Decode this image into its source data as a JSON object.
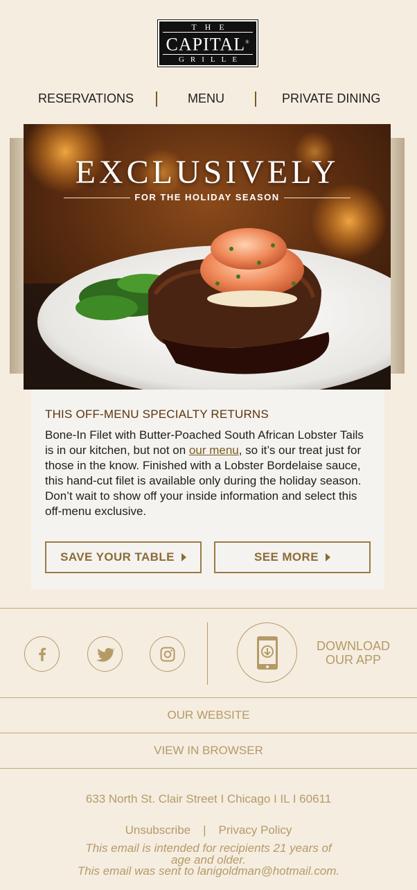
{
  "brand": {
    "the": "THE",
    "capital": "CAPITAL",
    "reg": "®",
    "grille": "GRILLE"
  },
  "nav": {
    "reservations": "RESERVATIONS",
    "menu": "MENU",
    "private_dining": "PRIVATE DINING"
  },
  "hero": {
    "headline": "EXCLUSIVELY",
    "subhead": "FOR THE HOLIDAY SEASON"
  },
  "feature": {
    "heading": "THIS OFF-MENU SPECIALTY RETURNS",
    "body_before_link": "Bone-In Filet with Butter-Poached South African Lobster Tails is in our kitchen, but not on ",
    "link_text": "our menu",
    "body_after_link": ", so it’s our treat just for those in the know. Finished with a Lobster Bordelaise sauce, this hand-cut filet is available only during the holiday season. Don’t wait to show off your inside information and select this off-menu exclusive.",
    "save_button": "SAVE YOUR TABLE",
    "more_button": "SEE MORE"
  },
  "social": {
    "icons": [
      "facebook-icon",
      "twitter-icon",
      "instagram-icon",
      "phone-download-icon"
    ],
    "download_line1": "DOWNLOAD",
    "download_line2": "OUR APP"
  },
  "links": {
    "website": "OUR WEBSITE",
    "browser": "VIEW IN BROWSER"
  },
  "footer": {
    "address": "633 North St. Clair Street I Chicago I IL I 60611",
    "unsubscribe": "Unsubscribe",
    "pipe": "|",
    "privacy": "Privacy Policy",
    "disclaimer_line1": "This email is intended for recipients 21 years of",
    "disclaimer_line2": "age and older.",
    "sent_to": "This email was sent to lanigoldman@hotmail.com."
  },
  "colors": {
    "background": "#f5ede0",
    "accent": "#b59a68",
    "button": "#8b6b38",
    "heading": "#5a3410"
  }
}
